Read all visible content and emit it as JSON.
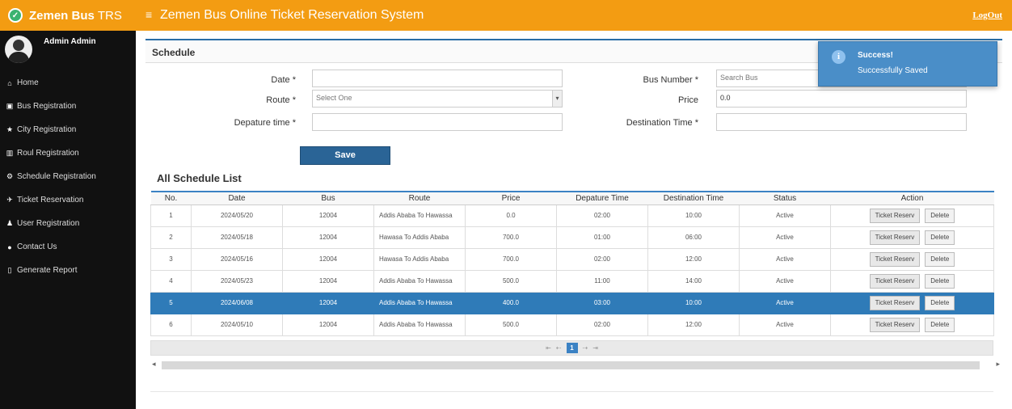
{
  "header": {
    "brand_name": "Zemen Bus",
    "brand_suffix": "TRS",
    "brand_logo_glyph": "✓",
    "menu_glyph": "≡",
    "app_title": "Zemen Bus Online Ticket Reservation System",
    "logout_label": "LogOut",
    "color": "#f39c12"
  },
  "sidebar": {
    "user_name": "Admin Admin",
    "items": [
      {
        "icon": "home-icon",
        "glyph": "⌂",
        "label": "Home"
      },
      {
        "icon": "bus-icon",
        "glyph": "▣",
        "label": "Bus Registration"
      },
      {
        "icon": "star-icon",
        "glyph": "★",
        "label": "City Registration"
      },
      {
        "icon": "road-icon",
        "glyph": "▥",
        "label": "Roul Registration"
      },
      {
        "icon": "gear-icon",
        "glyph": "⚙",
        "label": "Schedule Registration"
      },
      {
        "icon": "plane-icon",
        "glyph": "✈",
        "label": "Ticket Reservation"
      },
      {
        "icon": "user-icon",
        "glyph": "♟",
        "label": "User Registration"
      },
      {
        "icon": "chat-icon",
        "glyph": "●",
        "label": "Contact Us"
      },
      {
        "icon": "file-icon",
        "glyph": "▯",
        "label": "Generate Report"
      }
    ]
  },
  "form": {
    "title": "Schedule",
    "date_label": "Date *",
    "date_value": "",
    "route_label": "Route *",
    "route_value": "Select One",
    "departure_label": "Depature time *",
    "departure_value": "",
    "bus_number_label": "Bus Number *",
    "bus_number_placeholder": "Search Bus",
    "price_label": "Price",
    "price_value": "0.0",
    "destination_time_label": "Destination Time *",
    "destination_time_value": "",
    "save_label": "Save"
  },
  "list": {
    "title": "All Schedule List",
    "columns": [
      "No.",
      "Date",
      "Bus",
      "Route",
      "Price",
      "Depature Time",
      "Destination Time",
      "Status",
      "Action"
    ],
    "rows": [
      {
        "no": "1",
        "date": "2024/05/20",
        "bus": "12004",
        "route": "Addis Ababa To Hawassa",
        "price": "0.0",
        "dep": "02:00",
        "dest": "10:00",
        "status": "Active"
      },
      {
        "no": "2",
        "date": "2024/05/18",
        "bus": "12004",
        "route": "Hawasa To Addis Ababa",
        "price": "700.0",
        "dep": "01:00",
        "dest": "06:00",
        "status": "Active"
      },
      {
        "no": "3",
        "date": "2024/05/16",
        "bus": "12004",
        "route": "Hawasa To Addis Ababa",
        "price": "700.0",
        "dep": "02:00",
        "dest": "12:00",
        "status": "Active"
      },
      {
        "no": "4",
        "date": "2024/05/23",
        "bus": "12004",
        "route": "Addis Ababa To Hawassa",
        "price": "500.0",
        "dep": "11:00",
        "dest": "14:00",
        "status": "Active"
      },
      {
        "no": "5",
        "date": "2024/06/08",
        "bus": "12004",
        "route": "Addis Ababa To Hawassa",
        "price": "400.0",
        "dep": "03:00",
        "dest": "10:00",
        "status": "Active",
        "selected": true
      },
      {
        "no": "6",
        "date": "2024/05/10",
        "bus": "12004",
        "route": "Addis Ababa To Hawassa",
        "price": "500.0",
        "dep": "02:00",
        "dest": "12:00",
        "status": "Active"
      }
    ],
    "reserve_label": "Ticket Reserv",
    "delete_label": "Delete",
    "pager": {
      "first": "⇤",
      "prev": "⇠",
      "current_page": "1",
      "next": "⇢",
      "last": "⇥"
    },
    "scroll_left": "◂",
    "scroll_right": "▸"
  },
  "toast": {
    "icon_glyph": "i",
    "title": "Success!",
    "message": "Successfully Saved"
  }
}
